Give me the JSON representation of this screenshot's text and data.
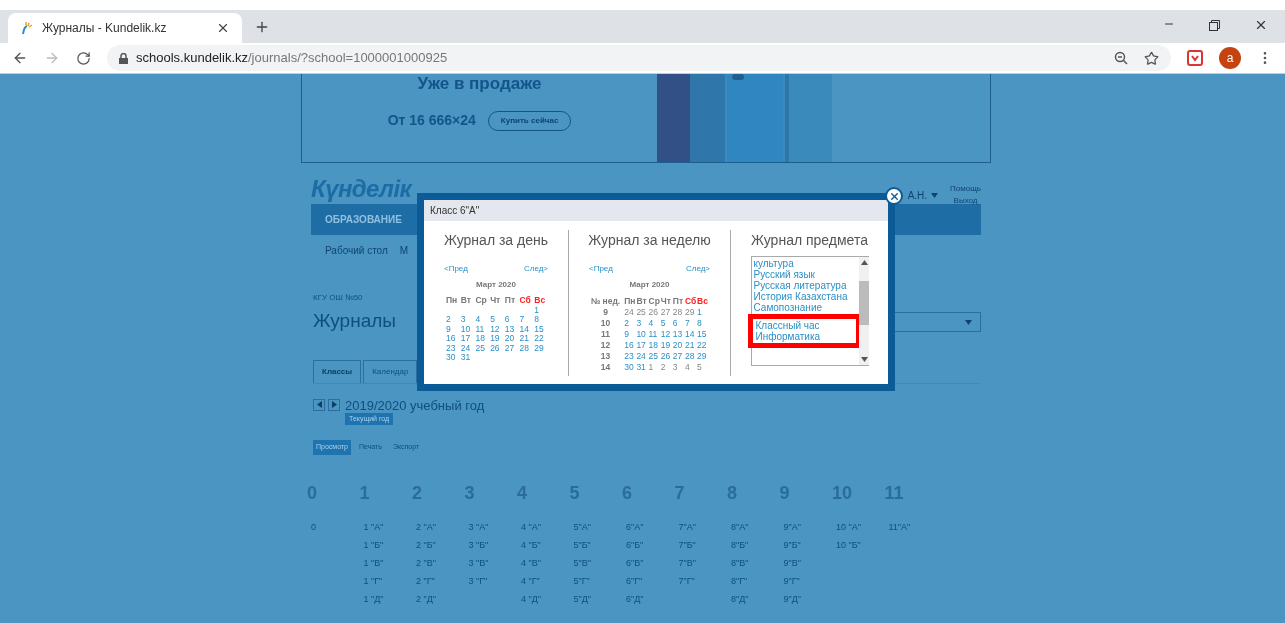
{
  "browser": {
    "tab_title": "Журналы - Kundelik.kz",
    "url_host": "schools.kundelik.kz",
    "url_path": "/journals/?school=1000001000925",
    "avatar": "a"
  },
  "page": {
    "banner": {
      "headline": "Уже в продаже",
      "price": "От 16 666×24",
      "button": "Купить сейчас"
    },
    "logo": "Күнделік",
    "user": "А.Н.",
    "links": [
      "Помощь",
      "Выход"
    ],
    "nav": "ОБРАЗОВАНИЕ",
    "subnav": [
      "Рабочий стол",
      "М"
    ],
    "org": "КГУ ОШ №50",
    "title": "Журналы",
    "tabs": [
      {
        "label": "Классы",
        "selected": true
      },
      {
        "label": "Календар",
        "selected": false
      }
    ],
    "year": "2019/2020 учебный год",
    "current_year": "Текущий год",
    "modes": [
      {
        "label": "Просмотр",
        "selected": true
      },
      {
        "label": "Печать",
        "selected": false
      },
      {
        "label": "Экспорт",
        "selected": false
      }
    ],
    "grades": [
      {
        "grade": "0",
        "classes": [
          "0"
        ]
      },
      {
        "grade": "1",
        "classes": [
          "1 \"А\"",
          "1 \"Б\"",
          "1 \"В\"",
          "1 \"Г\"",
          "1 \"Д\""
        ]
      },
      {
        "grade": "2",
        "classes": [
          "2 \"А\"",
          "2 \"Б\"",
          "2 \"В\"",
          "2 \"Г\"",
          "2 \"Д\""
        ]
      },
      {
        "grade": "3",
        "classes": [
          "3 \"А\"",
          "3 \"Б\"",
          "3 \"В\"",
          "3 \"Г\""
        ]
      },
      {
        "grade": "4",
        "classes": [
          "4 \"А\"",
          "4 \"Б\"",
          "4 \"В\"",
          "4 \"Г\"",
          "4 \"Д\""
        ]
      },
      {
        "grade": "5",
        "classes": [
          "5\"А\"",
          "5\"Б\"",
          "5\"В\"",
          "5\"Г\"",
          "5\"Д\""
        ]
      },
      {
        "grade": "6",
        "classes": [
          "6\"А\"",
          "6\"Б\"",
          "6\"В\"",
          "6\"Г\"",
          "6\"Д\""
        ]
      },
      {
        "grade": "7",
        "classes": [
          "7\"А\"",
          "7\"Б\"",
          "7\"В\"",
          "7\"Г\""
        ]
      },
      {
        "grade": "8",
        "classes": [
          "8\"А\"",
          "8\"Б\"",
          "8\"В\"",
          "8\"Г\"",
          "8\"Д\""
        ]
      },
      {
        "grade": "9",
        "classes": [
          "9\"А\"",
          "9\"Б\"",
          "9\"В\"",
          "9\"Г\"",
          "9\"Д\""
        ]
      },
      {
        "grade": "10",
        "classes": [
          "10 \"А\"",
          "10 \"Б\""
        ]
      },
      {
        "grade": "11",
        "classes": [
          "11\"А\""
        ]
      }
    ]
  },
  "modal": {
    "title": "Класс 6\"А\"",
    "day": {
      "heading": "Журнал за день",
      "prev": "<Пред",
      "next": "След>",
      "month": "Март 2020",
      "weekdays": [
        {
          "label": "Пн",
          "weekend": false
        },
        {
          "label": "Вт",
          "weekend": false
        },
        {
          "label": "Ср",
          "weekend": false
        },
        {
          "label": "Чт",
          "weekend": false
        },
        {
          "label": "Пт",
          "weekend": false
        },
        {
          "label": "Сб",
          "weekend": true
        },
        {
          "label": "Вс",
          "weekend": true
        }
      ],
      "weeks": [
        {
          "kind": "first",
          "days": [
            "1"
          ]
        },
        {
          "kind": "full",
          "days": [
            "2",
            "3",
            "4",
            "5",
            "6",
            "7",
            "8"
          ]
        },
        {
          "kind": "full",
          "days": [
            "9",
            "10",
            "11",
            "12",
            "13",
            "14",
            "15"
          ]
        },
        {
          "kind": "full",
          "days": [
            "16",
            "17",
            "18",
            "19",
            "20",
            "21",
            "22"
          ]
        },
        {
          "kind": "full",
          "days": [
            "23",
            "24",
            "25",
            "26",
            "27",
            "28",
            "29"
          ]
        },
        {
          "kind": "last",
          "days": [
            "30",
            "31"
          ]
        }
      ]
    },
    "week": {
      "heading": "Журнал за неделю",
      "prev": "<Пред",
      "next": "След>",
      "month": "Март 2020",
      "week_column": "№ нед.",
      "weekdays": [
        {
          "label": "Пн",
          "weekend": false
        },
        {
          "label": "Вт",
          "weekend": false
        },
        {
          "label": "Ср",
          "weekend": false
        },
        {
          "label": "Чт",
          "weekend": false
        },
        {
          "label": "Пт",
          "weekend": false
        },
        {
          "label": "Сб",
          "weekend": true
        },
        {
          "label": "Вс",
          "weekend": true
        }
      ],
      "rows": [
        {
          "week": "9",
          "days": [
            {
              "label": "24",
              "outside": true
            },
            {
              "label": "25",
              "outside": true
            },
            {
              "label": "26",
              "outside": true
            },
            {
              "label": "27",
              "outside": true
            },
            {
              "label": "28",
              "outside": true
            },
            {
              "label": "29",
              "outside": true
            },
            {
              "label": "1",
              "outside": false
            }
          ]
        },
        {
          "week": "10",
          "days": [
            {
              "label": "2",
              "outside": false
            },
            {
              "label": "3",
              "outside": false
            },
            {
              "label": "4",
              "outside": false
            },
            {
              "label": "5",
              "outside": false
            },
            {
              "label": "6",
              "outside": false
            },
            {
              "label": "7",
              "outside": false
            },
            {
              "label": "8",
              "outside": false
            }
          ]
        },
        {
          "week": "11",
          "days": [
            {
              "label": "9",
              "outside": false
            },
            {
              "label": "10",
              "outside": false
            },
            {
              "label": "11",
              "outside": false
            },
            {
              "label": "12",
              "outside": false
            },
            {
              "label": "13",
              "outside": false
            },
            {
              "label": "14",
              "outside": false
            },
            {
              "label": "15",
              "outside": false
            }
          ]
        },
        {
          "week": "12",
          "days": [
            {
              "label": "16",
              "outside": false
            },
            {
              "label": "17",
              "outside": false
            },
            {
              "label": "18",
              "outside": false
            },
            {
              "label": "19",
              "outside": false
            },
            {
              "label": "20",
              "outside": false
            },
            {
              "label": "21",
              "outside": false
            },
            {
              "label": "22",
              "outside": false
            }
          ]
        },
        {
          "week": "13",
          "days": [
            {
              "label": "23",
              "outside": false
            },
            {
              "label": "24",
              "outside": false
            },
            {
              "label": "25",
              "outside": false
            },
            {
              "label": "26",
              "outside": false
            },
            {
              "label": "27",
              "outside": false
            },
            {
              "label": "28",
              "outside": false
            },
            {
              "label": "29",
              "outside": false
            }
          ]
        },
        {
          "week": "14",
          "days": [
            {
              "label": "30",
              "outside": false
            },
            {
              "label": "31",
              "outside": false
            },
            {
              "label": "1",
              "outside": true
            },
            {
              "label": "2",
              "outside": true
            },
            {
              "label": "3",
              "outside": true
            },
            {
              "label": "4",
              "outside": true
            },
            {
              "label": "5",
              "outside": true
            }
          ]
        }
      ]
    },
    "subject": {
      "heading": "Журнал предмета",
      "items": [
        "культура",
        "Русский язык",
        "Русская литература",
        "История Казахстана",
        "Самопознание"
      ],
      "highlight": {
        "items": [
          "Классный час",
          "Информатика"
        ]
      }
    }
  }
}
